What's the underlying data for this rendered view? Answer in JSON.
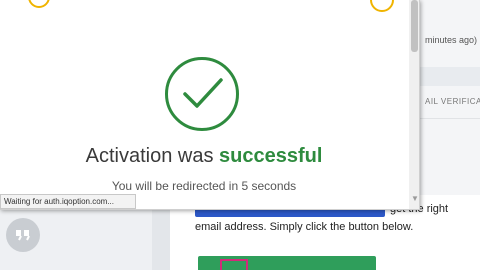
{
  "popup": {
    "title_prefix": "Activation was ",
    "title_accent": "successful",
    "subtitle": "You will be redirected in 5 seconds",
    "status_text": "Waiting for auth.iqoption.com...",
    "icon": "check-circle-icon",
    "accent_color": "#2e8b3e"
  },
  "background": {
    "time_ago": "minutes ago)",
    "section_label": "AIL VERIFICAT",
    "body_text_line1": "get the right",
    "body_text_line2": "email address. Simply click the button below.",
    "button_color": "#2f9e5b"
  }
}
